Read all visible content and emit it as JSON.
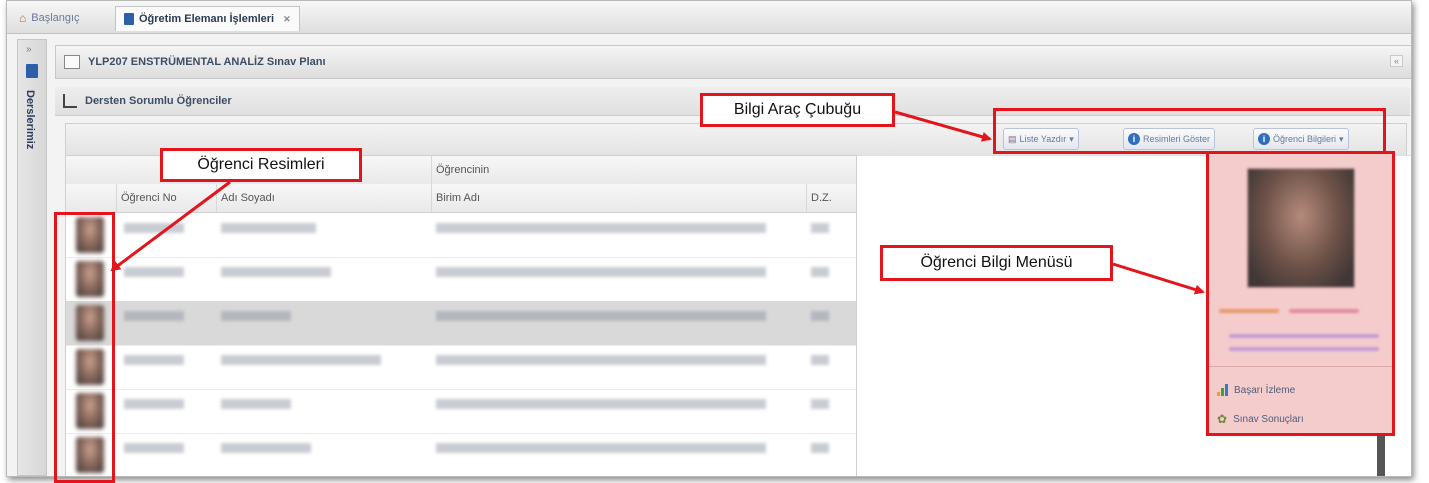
{
  "tabs": [
    {
      "label": "Başlangıç"
    },
    {
      "label": "Öğretim Elemanı İşlemleri",
      "close": "✕"
    }
  ],
  "sidebar": {
    "collapse": "»",
    "label": "Derslerimiz"
  },
  "panel": {
    "title": "YLP207 ENSTRÜMENTAL ANALİZ Sınav Planı",
    "collapse": "«"
  },
  "section": {
    "title": "Dersten Sorumlu Öğrenciler"
  },
  "grid": {
    "group_header": "Öğrencinin",
    "columns": [
      "Öğrenci No",
      "Adı Soyadı",
      "Birim Adı",
      "D.Z."
    ]
  },
  "toolbar": {
    "print_label": "Liste Yazdır",
    "show_photos_label": "Resimleri Göster",
    "student_info_label": "Öğrenci Bilgileri"
  },
  "menu": {
    "items": [
      {
        "label": "Başarı İzleme",
        "icon": "bar-chart-icon"
      },
      {
        "label": "Sınav Sonuçları",
        "icon": "exam-results-icon"
      }
    ]
  },
  "annotations": {
    "toolbar": "Bilgi Araç Çubuğu",
    "photos": "Öğrenci Resimleri",
    "menu": "Öğrenci Bilgi Menüsü"
  },
  "colors": {
    "annotation_red": "#e4141c",
    "menu_bg": "#f5cccc",
    "selected_row": "#d9d9d9"
  }
}
